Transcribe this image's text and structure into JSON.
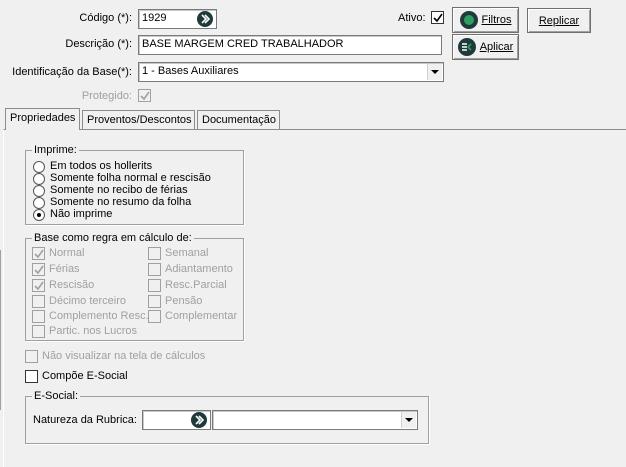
{
  "header": {
    "codigo_label": "Código (*):",
    "codigo_value": "1929",
    "descricao_label": "Descrição (*):",
    "descricao_value": "BASE MARGEM CRED TRABALHADOR",
    "identificacao_label": "Identificação da Base(*):",
    "identificacao_value": "1 - Bases Auxiliares",
    "protegido_label": "Protegido:",
    "ativo_label": "Ativo:"
  },
  "buttons": {
    "filtros": "Filtros",
    "replicar": "Replicar",
    "aplicar": "Aplicar"
  },
  "tabs": [
    "Propriedades",
    "Proventos/Descontos",
    "Documentação"
  ],
  "imprime": {
    "title": "Imprime:",
    "options": [
      "Em todos os hollerits",
      "Somente folha normal e rescisão",
      "Somente no recibo de férias",
      "Somente no resumo da folha",
      "Não imprime"
    ],
    "selected_index": 4
  },
  "base_regra": {
    "title": "Base como regra em cálculo de:",
    "left": [
      {
        "label": "Normal",
        "checked": true
      },
      {
        "label": "Férias",
        "checked": true
      },
      {
        "label": "Rescisão",
        "checked": true
      },
      {
        "label": "Décimo terceiro",
        "checked": false
      },
      {
        "label": "Complemento Resc.",
        "checked": false
      },
      {
        "label": "Partic. nos Lucros",
        "checked": false
      }
    ],
    "right": [
      {
        "label": "Semanal",
        "checked": false
      },
      {
        "label": "Adiantamento",
        "checked": false
      },
      {
        "label": "Resc.Parcial",
        "checked": false
      },
      {
        "label": "Pensão",
        "checked": false
      },
      {
        "label": "Complementar",
        "checked": false
      }
    ]
  },
  "nao_visualizar_label": "Não visualizar na tela de cálculos",
  "compoe_esocial_label": "Compõe E-Social",
  "esocial": {
    "title": "E-Social:",
    "natureza_label": "Natureza da Rubrica:",
    "natureza_value": "",
    "natureza_combo_value": ""
  },
  "colors": {
    "window_bg": "#f0f0f0",
    "icon_green": "#2e9e63",
    "icon_dark": "#1f3a3a"
  }
}
